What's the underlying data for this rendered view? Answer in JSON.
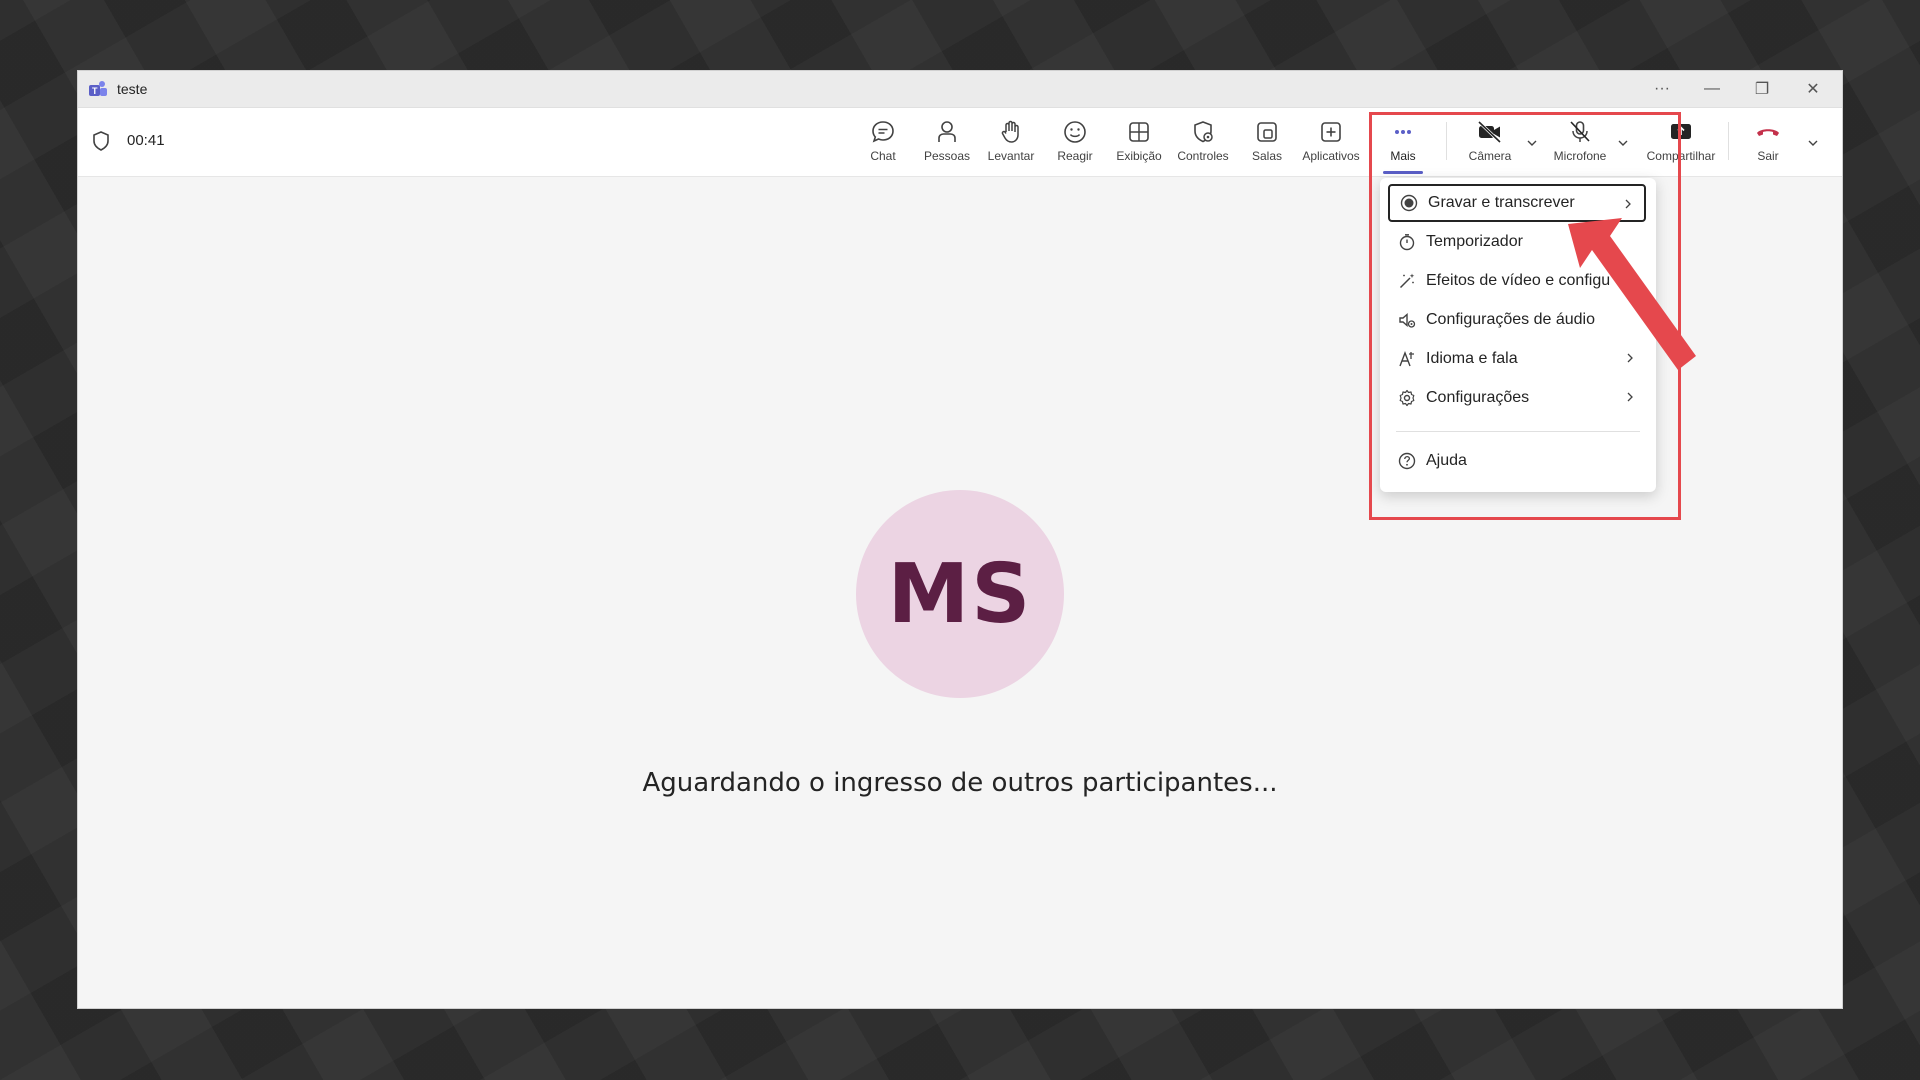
{
  "window": {
    "title": "teste",
    "controls": {
      "more": "···",
      "minimize": "—",
      "restore": "❐",
      "close": "✕"
    }
  },
  "toolbar": {
    "elapsed": "00:41",
    "buttons": [
      {
        "label": "Chat",
        "icon": "chat-icon"
      },
      {
        "label": "Pessoas",
        "icon": "person-icon"
      },
      {
        "label": "Levantar",
        "icon": "hand-icon"
      },
      {
        "label": "Reagir",
        "icon": "smiley-icon"
      },
      {
        "label": "Exibição",
        "icon": "grid-icon"
      },
      {
        "label": "Controles",
        "icon": "shield-gear-icon"
      },
      {
        "label": "Salas",
        "icon": "rooms-icon"
      },
      {
        "label": "Aplicativos",
        "icon": "plus-square-icon"
      },
      {
        "label": "Mais",
        "icon": "more-dots-icon",
        "active": true
      },
      {
        "label": "Câmera",
        "icon": "camera-off-icon"
      },
      {
        "label": "Microfone",
        "icon": "mic-off-icon"
      },
      {
        "label": "Compartilhar",
        "icon": "share-icon"
      },
      {
        "label": "Sair",
        "icon": "hangup-icon"
      }
    ]
  },
  "more_menu": {
    "items": [
      {
        "label": "Gravar e transcrever",
        "icon": "record-icon",
        "submenu": true,
        "selected": true
      },
      {
        "label": "Temporizador",
        "icon": "stopwatch-icon",
        "submenu": false
      },
      {
        "label": "Efeitos de vídeo e configu",
        "icon": "magic-wand-icon",
        "submenu": false
      },
      {
        "label": "Configurações de áudio",
        "icon": "speaker-gear-icon",
        "submenu": false
      },
      {
        "label": "Idioma e fala",
        "icon": "language-icon",
        "submenu": true
      },
      {
        "label": "Configurações",
        "icon": "gear-icon",
        "submenu": true
      },
      {
        "label": "Ajuda",
        "icon": "help-icon",
        "submenu": false
      }
    ]
  },
  "stage": {
    "avatar_initials": "MS",
    "waiting_text": "Aguardando o ingresso de outros participantes..."
  },
  "colors": {
    "accent": "#5b5fc7",
    "annotation": "#e5484d",
    "hangup": "#c4314b",
    "avatar_bg": "#ecd4e3",
    "avatar_text": "#5c1f44"
  }
}
